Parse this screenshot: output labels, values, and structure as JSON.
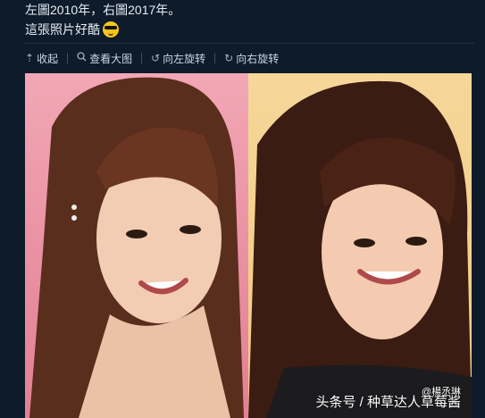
{
  "post": {
    "line1": "左圖2010年，右圖2017年。",
    "line2": "這張照片好酷"
  },
  "toolbar": {
    "collapse": "收起",
    "view_large": "查看大图",
    "rotate_left": "向左旋转",
    "rotate_right": "向右旋转"
  },
  "image": {
    "watermark": "头条号 / 种草达人草莓酱",
    "overlay_tag": "@楊丞琳"
  },
  "colors": {
    "background": "#0d1b2a",
    "left_panel_bg": "#e88ea0",
    "right_panel_bg": "#f1c97f"
  },
  "icons": [
    "collapse-up-arrow-icon",
    "search-icon",
    "rotate-left-icon",
    "rotate-right-icon",
    "cool-sunglasses-emoji"
  ]
}
